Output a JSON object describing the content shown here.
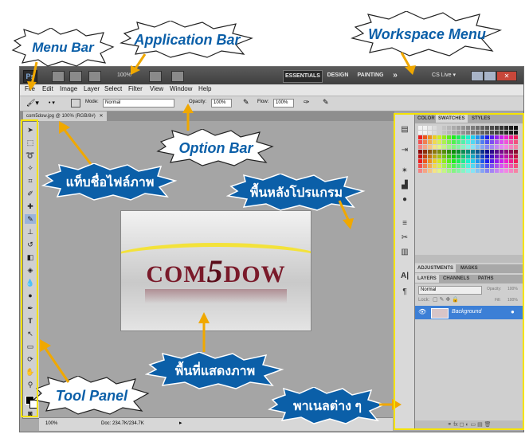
{
  "annotations": {
    "menu_bar": "Menu Bar",
    "application_bar": "Application Bar",
    "workspace_menu": "Workspace Menu",
    "option_bar": "Option Bar",
    "file_tab": "แท็บชื่อไฟล์ภาพ",
    "app_background": "พื้นหลังโปรแกรม",
    "display_area": "พื้นที่แสดงภาพ",
    "tool_panel": "Tool Panel",
    "panels": "พาเนลต่าง ๆ"
  },
  "app_bar": {
    "logo": "Ps",
    "zoom": "100%",
    "workspaces": [
      "ESSENTIALS",
      "DESIGN",
      "PAINTING"
    ],
    "more": "»",
    "cs_live": "CS Live ▾"
  },
  "menu": [
    "File",
    "Edit",
    "Image",
    "Layer",
    "Select",
    "Filter",
    "View",
    "Window",
    "Help"
  ],
  "options": {
    "mode_label": "Mode:",
    "mode_value": "Normal",
    "opacity_label": "Opacity:",
    "opacity_value": "100%",
    "flow_label": "Flow:",
    "flow_value": "100%"
  },
  "document_tab": "com5dow.jpg @ 100% (RGB/8#)",
  "document_logo": {
    "prefix": "COM",
    "digit": "5",
    "suffix": "DOW"
  },
  "status": {
    "zoom": "100%",
    "doc": "Doc: 234.7K/234.7K"
  },
  "panels": {
    "color_tabs": [
      "COLOR",
      "SWATCHES",
      "STYLES"
    ],
    "adjust_tabs": [
      "ADJUSTMENTS",
      "MASKS"
    ],
    "layer_tabs": [
      "LAYERS",
      "CHANNELS",
      "PATHS"
    ],
    "blend_mode": "Normal",
    "opacity_label": "Opacity:",
    "opacity_value": "100%",
    "lock_label": "Lock:",
    "fill_label": "Fill:",
    "fill_value": "100%",
    "layer_name": "Background"
  },
  "colors": {
    "accent": "#0b5fa8",
    "logo_red": "#7a1a2a",
    "selected_layer": "#3c7fd6"
  }
}
